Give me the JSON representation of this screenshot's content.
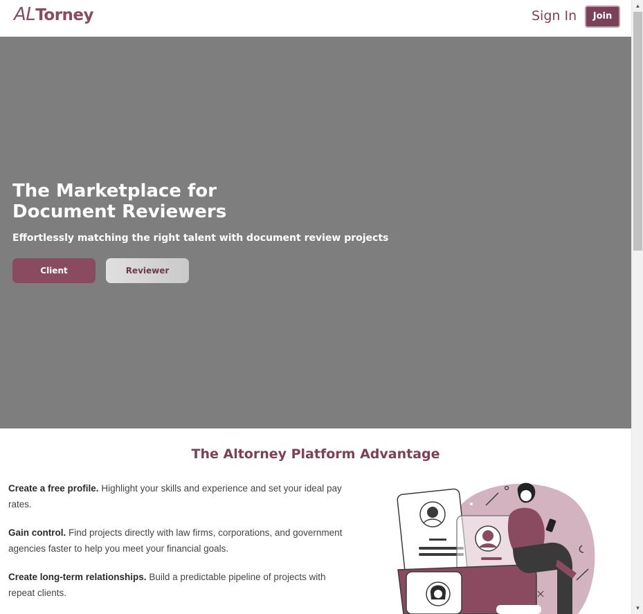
{
  "header": {
    "logo_prefix": "AL",
    "logo_suffix": "Torney",
    "sign_in": "Sign In",
    "join": "Join"
  },
  "hero": {
    "title_line1": "The Marketplace for",
    "title_line2": "Document Reviewers",
    "subtitle": "Effortlessly matching the right talent with document review projects",
    "client_button": "Client",
    "reviewer_button": "Reviewer"
  },
  "advantage": {
    "title": "The Altorney Platform Advantage",
    "features": [
      {
        "heading": "Create a free profile.",
        "text": "Highlight your skills and experience and set your ideal pay rates."
      },
      {
        "heading": "Gain control.",
        "text": "Find projects directly with law firms, corporations, and government agencies faster to help you meet your financial goals."
      },
      {
        "heading": "Create long-term relationships.",
        "text": "Build a predictable pipeline of projects with repeat clients."
      }
    ]
  },
  "colors": {
    "brand": "#7d4058",
    "hero_bg": "#7e7e7e",
    "client_button": "#8a4a60"
  },
  "icons": [
    "scroll-up-arrow-icon",
    "scroll-down-arrow-icon"
  ]
}
